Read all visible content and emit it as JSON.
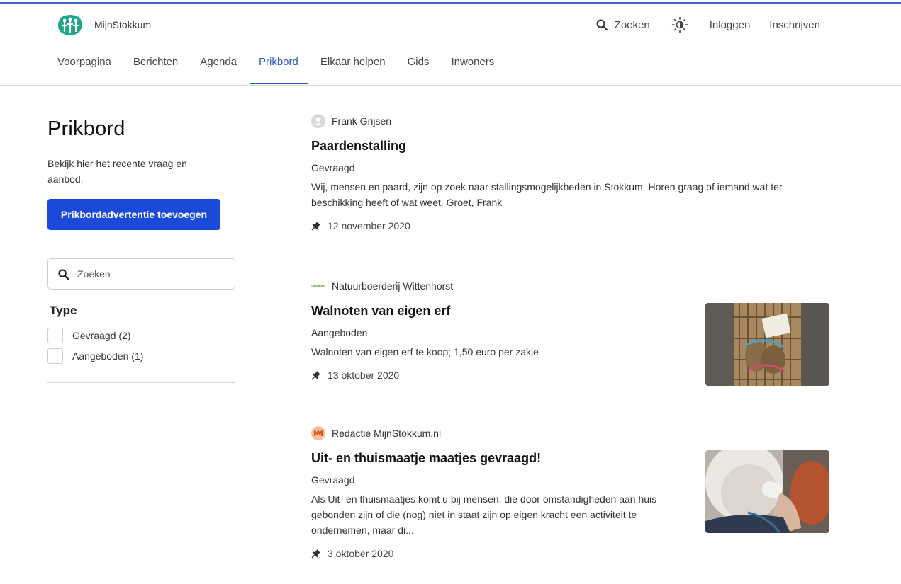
{
  "app": {
    "name": "MijnStokkum"
  },
  "header": {
    "search_label": "Zoeken",
    "login_label": "Inloggen",
    "signup_label": "Inschrijven"
  },
  "nav": {
    "items": [
      {
        "label": "Voorpagina"
      },
      {
        "label": "Berichten"
      },
      {
        "label": "Agenda"
      },
      {
        "label": "Prikbord"
      },
      {
        "label": "Elkaar helpen"
      },
      {
        "label": "Gids"
      },
      {
        "label": "Inwoners"
      }
    ],
    "active_label": "Prikbord"
  },
  "sidebar": {
    "title": "Prikbord",
    "intro": "Bekijk hier het recente vraag en aanbod.",
    "add_button": "Prikbordadvertentie toevoegen",
    "search_placeholder": "Zoeken",
    "filter_title": "Type",
    "filters": [
      {
        "label": "Gevraagd (2)",
        "checked": false
      },
      {
        "label": "Aangeboden (1)",
        "checked": false
      }
    ]
  },
  "posts": [
    {
      "author": "Frank Grijsen",
      "title": "Paardenstalling",
      "type": "Gevraagd",
      "body": "Wij, mensen en paard, zijn op zoek naar stallingsmogelijkheden in Stokkum. Horen graag of iemand wat ter beschikking heeft of wat weet. Groet, Frank",
      "date": "12 november 2020"
    },
    {
      "author": "Natuurboerderij Wittenhorst",
      "title": "Walnoten van eigen erf",
      "type": "Aangeboden",
      "body": "Walnoten van eigen erf te koop; 1,50 euro per zakje",
      "date": "13 oktober 2020",
      "image_label": "walnoten 1,50"
    },
    {
      "author": "Redactie MijnStokkum.nl",
      "title": "Uit- en thuismaatje maatjes gevraagd!",
      "type": "Gevraagd",
      "body": "Als Uit- en thuismaatjes komt u bij mensen, die door omstandigheden aan huis gebonden zijn of die (nog) niet in staat zijn op eigen kracht een activiteit te ondernemen, maar di...",
      "date": "3 oktober 2020"
    }
  ],
  "colors": {
    "accent": "#2f56c5",
    "button": "#1b49d8",
    "logo": "#1fa58a"
  }
}
